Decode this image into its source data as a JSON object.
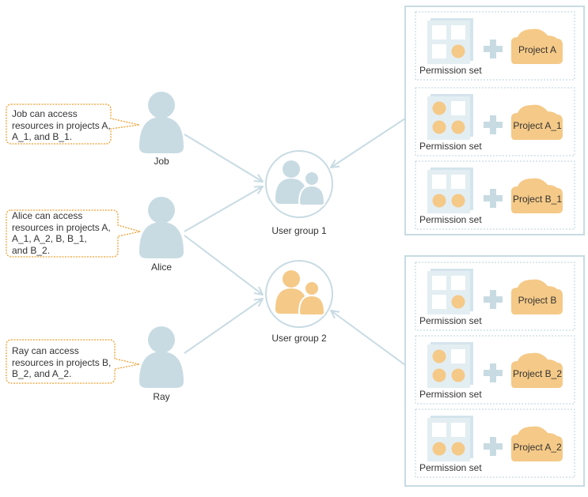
{
  "colors": {
    "person_fill": "#c8dbe3",
    "line": "#c8dbe3",
    "callout_border": "#f0a030",
    "orange": "#f5c987",
    "panel_border": "#c8dbe3",
    "dash_border": "#b9d0db"
  },
  "users": [
    {
      "name": "Job",
      "callout": "Job can access\nresources in projects A,\nA_1, and B_1."
    },
    {
      "name": "Alice",
      "callout": "Alice can access\nresources in projects A,\nA_1, A_2, B, B_1,\nand B_2."
    },
    {
      "name": "Ray",
      "callout": "Ray can access\nresources in projects B,\nB_2, and A_2."
    }
  ],
  "groups": [
    {
      "name": "User group 1",
      "color": "blue"
    },
    {
      "name": "User group 2",
      "color": "orange"
    }
  ],
  "panels": [
    {
      "group": "User group 1",
      "items": [
        {
          "label": "Permission set",
          "project": "Project A",
          "dots": [
            false,
            false,
            false,
            true
          ]
        },
        {
          "label": "Permission set",
          "project": "Project A_1",
          "dots": [
            true,
            false,
            true,
            true
          ]
        },
        {
          "label": "Permission set",
          "project": "Project B_1",
          "dots": [
            false,
            false,
            true,
            true
          ]
        }
      ]
    },
    {
      "group": "User group 2",
      "items": [
        {
          "label": "Permission set",
          "project": "Project B",
          "dots": [
            false,
            false,
            false,
            true
          ]
        },
        {
          "label": "Permission set",
          "project": "Project B_2",
          "dots": [
            true,
            false,
            true,
            true
          ]
        },
        {
          "label": "Permission set",
          "project": "Project A_2",
          "dots": [
            false,
            false,
            true,
            true
          ]
        }
      ]
    }
  ]
}
